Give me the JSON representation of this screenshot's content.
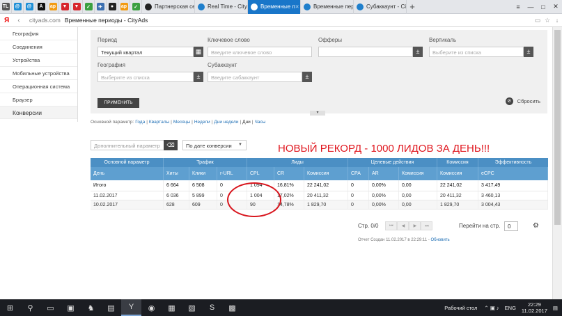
{
  "browser": {
    "pinned_tabs": [
      {
        "label": "TL",
        "color": "#555"
      },
      {
        "label": "@",
        "color": "#1f8fd6"
      },
      {
        "label": "@",
        "color": "#1f8fd6"
      },
      {
        "label": "A",
        "color": "#111"
      },
      {
        "label": "ap",
        "color": "#f29b11"
      },
      {
        "label": "▼",
        "color": "#d7262d"
      },
      {
        "label": "▼",
        "color": "#d7262d"
      },
      {
        "label": "✓",
        "color": "#3aa040"
      },
      {
        "label": "✈",
        "color": "#3b6fb0"
      },
      {
        "label": "●",
        "color": "#222"
      },
      {
        "label": "ap",
        "color": "#f29b11"
      },
      {
        "label": "✓",
        "color": "#3aa040"
      }
    ],
    "tabs": [
      {
        "label": "Партнерская се",
        "fav_color": "#222",
        "active": false
      },
      {
        "label": "Real Time - City",
        "fav_color": "#1f7fcc",
        "active": false
      },
      {
        "label": "Временные п",
        "fav_color": "#fff",
        "active": true
      },
      {
        "label": "Временные пер",
        "fav_color": "#1f7fcc",
        "active": false
      },
      {
        "label": "Субаккаунт - Ci",
        "fav_color": "#1f7fcc",
        "active": false
      }
    ],
    "new_tab": "+",
    "window_controls": [
      "≡",
      "—",
      "□",
      "✕"
    ],
    "address": {
      "brand": "Я",
      "back": "‹",
      "host": "cityads.com",
      "title": "Временные периоды - CityAds",
      "icons": [
        "▭",
        "☆",
        "↓"
      ]
    }
  },
  "sidebar": {
    "items": [
      "География",
      "Соединения",
      "Устройства",
      "Мобильные устройства",
      "Операционная система",
      "Браузер"
    ],
    "section": "Конверсии"
  },
  "filters": {
    "period_label": "Период",
    "period_value": "Текущий квартал",
    "keyword_label": "Ключевое слово",
    "keyword_placeholder": "Введите ключевое слово",
    "offers_label": "Офферы",
    "vertical_label": "Вертикаль",
    "vertical_placeholder": "Выберите из списка",
    "geo_label": "География",
    "geo_placeholder": "Выберите из списка",
    "subaccount_label": "Субаккаунт",
    "subaccount_placeholder": "Введите сабаккаунт",
    "apply": "ПРИМЕНИТЬ",
    "reset": "Сбросить",
    "plus": "±"
  },
  "basic_param": {
    "label": "Основной параметр:",
    "links": [
      "Года",
      "Кварталы",
      "Месяцы",
      "Недели",
      "Дни недели"
    ],
    "current": "Дни",
    "last": "Часы"
  },
  "toolbar": {
    "extra_param_placeholder": "Дополнительный параметр",
    "sort_value": "По дате конверсии"
  },
  "annotation": "НОВЫЙ РЕКОРД - 1000 ЛИДОВ ЗА ДЕНЬ!!!",
  "table": {
    "groups": [
      "Основной параметр",
      "Трафик",
      "Лиды",
      "Целевые действия",
      "Комиссия",
      "Эффективность"
    ],
    "headers": [
      "День",
      "Хиты",
      "Клики",
      "r-URL",
      "CPL",
      "CR",
      "Комиссия",
      "CPA",
      "AR",
      "Комиссия",
      "Комиссия",
      "eCPC"
    ],
    "rows": [
      [
        "Итого",
        "6 664",
        "6 508",
        "0",
        "1 094",
        "16,81%",
        "22 241,02",
        "0",
        "0,00%",
        "0,00",
        "22 241,02",
        "3 417,49"
      ],
      [
        "11.02.2017",
        "6 036",
        "5 899",
        "0",
        "1 004",
        "17,02%",
        "20 411,32",
        "0",
        "0,00%",
        "0,00",
        "20 411,32",
        "3 460,13"
      ],
      [
        "10.02.2017",
        "628",
        "609",
        "0",
        "90",
        "14,78%",
        "1 829,70",
        "0",
        "0,00%",
        "0,00",
        "1 829,70",
        "3 004,43"
      ]
    ]
  },
  "pager": {
    "label": "Стр. 0/0",
    "buttons": [
      "⏮",
      "◀",
      "▶",
      "⏭"
    ],
    "goto_label": "Перейти на стр.",
    "goto_value": "0"
  },
  "report": {
    "text": "Отчет Создан 11.02.2017 в 22:29:11 -",
    "update": "Обновить"
  },
  "taskbar": {
    "apps": [
      {
        "icon": "⊞",
        "name": "start"
      },
      {
        "icon": "⚲",
        "name": "search"
      },
      {
        "icon": "▭",
        "name": "task-view"
      },
      {
        "icon": "▣",
        "name": "app-1"
      },
      {
        "icon": "♞",
        "name": "app-2"
      },
      {
        "icon": "▤",
        "name": "app-3"
      },
      {
        "icon": "Y",
        "name": "yandex-browser"
      },
      {
        "icon": "◉",
        "name": "chrome"
      },
      {
        "icon": "▦",
        "name": "app-4"
      },
      {
        "icon": "▧",
        "name": "app-5"
      },
      {
        "icon": "S",
        "name": "skype"
      },
      {
        "icon": "▩",
        "name": "app-6"
      }
    ],
    "desktop": "Рабочий стол",
    "lang": "ENG",
    "time": "22:29",
    "date": "11.02.2017"
  }
}
